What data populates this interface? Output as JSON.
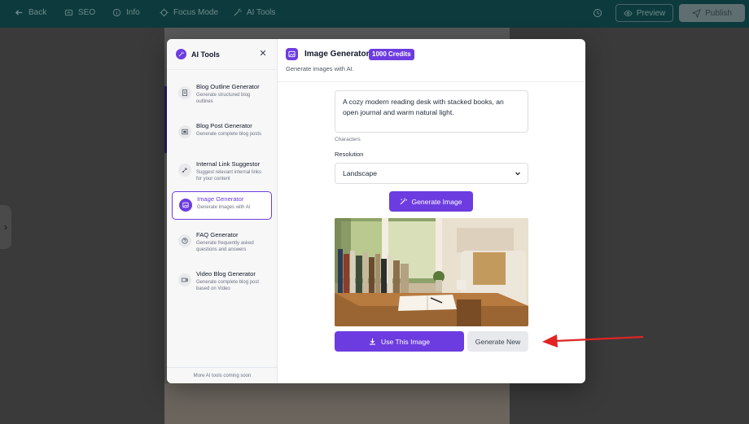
{
  "topbar": {
    "back": "Back",
    "seo": "SEO",
    "info": "Info",
    "focus_mode": "Focus Mode",
    "ai_tools": "AI Tools",
    "preview": "Preview",
    "publish": "Publish"
  },
  "sidebar": {
    "title": "AI Tools",
    "items": [
      {
        "title": "Blog Outline Generator",
        "desc": "Generate structured blog outlines",
        "icon": "document-icon"
      },
      {
        "title": "Blog Post Generator",
        "desc": "Generate complete blog posts",
        "icon": "post-icon"
      },
      {
        "title": "Internal Link Suggestor",
        "desc": "Suggest relevant internal links for your content",
        "icon": "link-icon"
      },
      {
        "title": "Image Generator",
        "desc": "Generate images with AI",
        "icon": "image-icon"
      },
      {
        "title": "FAQ Generator",
        "desc": "Generate frequently asked questions and answers",
        "icon": "question-icon"
      },
      {
        "title": "Video Blog Generator",
        "desc": "Generate complete blog post based on Video",
        "icon": "video-icon"
      }
    ],
    "footer": "More AI tools coming soon"
  },
  "main": {
    "title": "Image Generator",
    "credits": "1000 Credits",
    "subtitle": "Generate images with AI.",
    "prompt": "A cozy modern reading desk with stacked books, an open journal and warm natural light.",
    "characters_label": "Characters",
    "resolution_label": "Resolution",
    "resolution_value": "Landscape",
    "generate_button": "Generate Image",
    "use_button": "Use This Image",
    "new_button": "Generate New"
  },
  "colors": {
    "accent": "#6d3ce0",
    "topbar": "#0d3a3c",
    "arrow": "#e02424"
  }
}
